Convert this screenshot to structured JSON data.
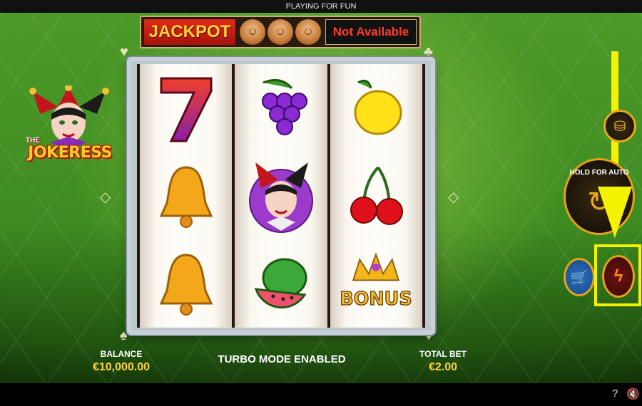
{
  "top_bar": {
    "text": "PLAYING FOR FUN"
  },
  "jackpot": {
    "label": "JACKPOT",
    "status": "Not Available"
  },
  "logo": {
    "the": "THE",
    "name": "JOKERESS"
  },
  "reels": [
    [
      "7",
      "bell",
      "bell"
    ],
    [
      "grapes",
      "jokeress",
      "watermelon"
    ],
    [
      "lemon",
      "cherries",
      "bonus"
    ]
  ],
  "symbols": {
    "bonus_text": "BONUS"
  },
  "controls": {
    "autoplay_label": "HOLD FOR AUTO",
    "icons": {
      "coin": "coin-stack-icon",
      "autoplay": "autoplay-arrows-icon",
      "shop": "shopping-cart-icon",
      "turbo": "lightning-bolt-icon"
    }
  },
  "status": {
    "balance_label": "BALANCE",
    "balance_value": "€10,000.00",
    "message": "TURBO MODE ENABLED",
    "total_bet_label": "TOTAL BET",
    "total_bet_value": "€2.00"
  },
  "colors": {
    "accent_gold": "#e3a21a",
    "highlight_yellow": "#f4f200",
    "jackpot_red": "#e02a1a",
    "value_yellow": "#ffd43a"
  }
}
